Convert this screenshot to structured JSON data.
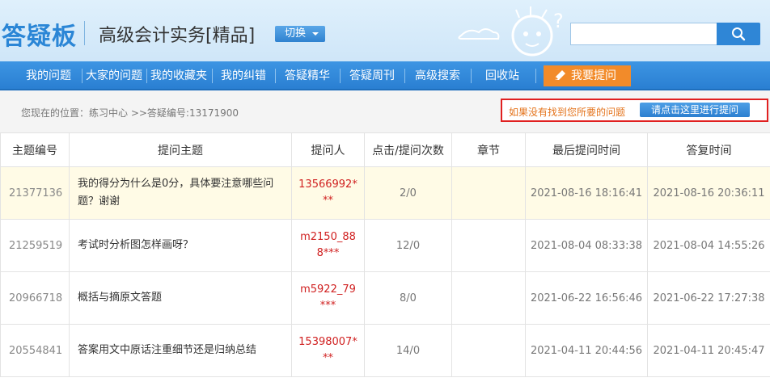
{
  "header": {
    "logo": "答疑板",
    "course_title": "高级会计实务[精品]",
    "switch_label": "切换",
    "search_placeholder": ""
  },
  "nav": {
    "items": [
      "我的问题",
      "大家的问题",
      "我的收藏夹",
      "我的纠错",
      "答疑精华",
      "答疑周刊",
      "高级搜索",
      "回收站"
    ],
    "ask_label": "我要提问"
  },
  "breadcrumb": {
    "text": "您现在的位置：练习中心 >>答疑编号:13171900"
  },
  "hint": {
    "text": "如果没有找到您所要的问题",
    "button": "请点击这里进行提问"
  },
  "table": {
    "headers": [
      "主题编号",
      "提问主题",
      "提问人",
      "点击/提问次数",
      "章节",
      "最后提问时间",
      "答复时间"
    ],
    "rows": [
      {
        "id": "21377136",
        "subject": "我的得分为什么是0分，具体要注意哪些问题？谢谢",
        "user": "13566992***",
        "count": "2/0",
        "chapter": "",
        "last_time": "2021-08-16 18:16:41",
        "reply_time": "2021-08-16 20:36:11"
      },
      {
        "id": "21259519",
        "subject": "考试时分析图怎样画呀？",
        "user": "m2150_888***",
        "count": "12/0",
        "chapter": "",
        "last_time": "2021-08-04 08:33:38",
        "reply_time": "2021-08-04 14:55:26"
      },
      {
        "id": "20966718",
        "subject": "概括与摘原文答题",
        "user": "m5922_79***",
        "count": "8/0",
        "chapter": "",
        "last_time": "2021-06-22 16:56:46",
        "reply_time": "2021-06-22 17:27:38"
      },
      {
        "id": "20554841",
        "subject": "答案用文中原话注重细节还是归纳总结",
        "user": "15398007***",
        "count": "14/0",
        "chapter": "",
        "last_time": "2021-04-11 20:44:56",
        "reply_time": "2021-04-11 20:45:47"
      }
    ]
  },
  "colors": {
    "brand_blue": "#2f86d6",
    "accent_orange": "#f28b2a",
    "user_red": "#d02020",
    "hint_border": "#e02020",
    "row_highlight": "#fffbe6"
  }
}
